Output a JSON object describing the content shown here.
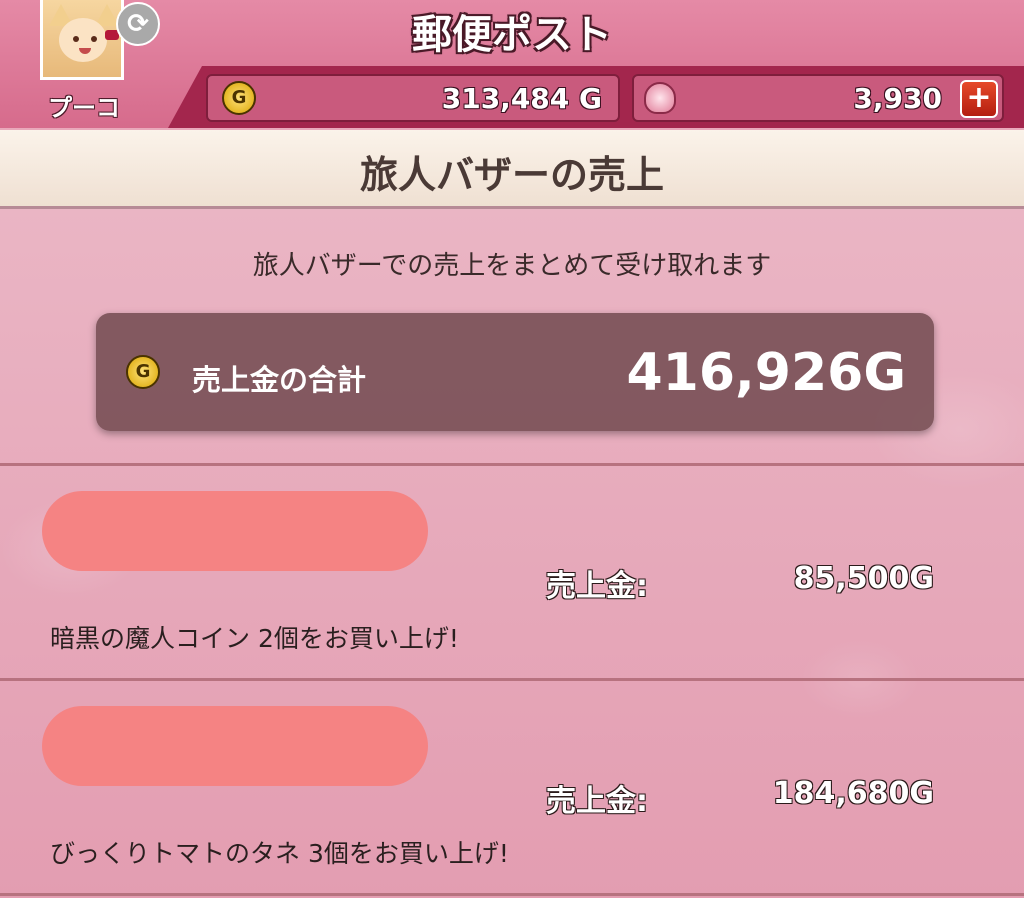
{
  "header": {
    "title": "郵便ポスト",
    "player_name": "プーコ",
    "swap_icon": "refresh-icon",
    "gold_amount": "313,484 G",
    "gem_amount": "3,930",
    "plus_symbol": "+"
  },
  "section": {
    "title": "旅人バザーの売上"
  },
  "main": {
    "instruction": "旅人バザーでの売上をまとめて受け取れます",
    "coin_symbol": "G",
    "total_label": "売上金の合計",
    "total_value": "416,926G",
    "sales": [
      {
        "label": "売上金:",
        "value": "85,500G",
        "description": "暗黒の魔人コイン 2個をお買い上げ!"
      },
      {
        "label": "売上金:",
        "value": "184,680G",
        "description": "びっくりトマトのタネ 3個をお買い上げ!"
      }
    ]
  },
  "colors": {
    "header_pink": "#d66b8c",
    "currency_bar": "#a3264d",
    "redaction": "#f58383",
    "plus_button": "#d0301a"
  }
}
